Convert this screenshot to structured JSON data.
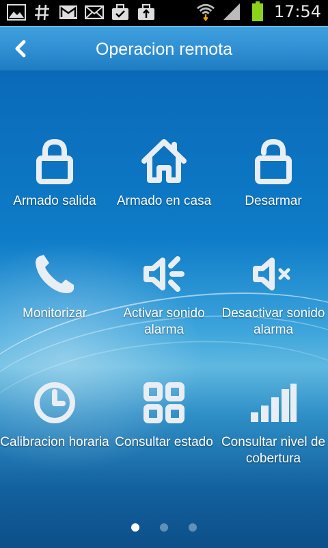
{
  "status_bar": {
    "time": "17:54",
    "icons": [
      "gallery-icon",
      "hash-icon",
      "gmail-icon",
      "mail-icon",
      "briefcase-check-icon",
      "briefcase-upload-icon",
      "wifi-icon",
      "signal-icon",
      "battery-icon"
    ]
  },
  "header": {
    "title": "Operacion remota",
    "back_icon": "chevron-left-icon"
  },
  "grid": [
    {
      "label": "Armado salida",
      "icon": "lock-icon"
    },
    {
      "label": "Armado en casa",
      "icon": "home-icon"
    },
    {
      "label": "Desarmar",
      "icon": "unlock-icon"
    },
    {
      "label": "Monitorizar",
      "icon": "phone-icon"
    },
    {
      "label": "Activar sonido alarma",
      "icon": "volume-on-icon"
    },
    {
      "label": "Desactivar sonido alarma",
      "icon": "volume-mute-icon"
    },
    {
      "label": "Calibracion horaria",
      "icon": "clock-icon"
    },
    {
      "label": "Consultar estado",
      "icon": "grid-icon"
    },
    {
      "label": "Consultar nivel de cobertura",
      "icon": "coverage-bars-icon"
    }
  ],
  "pager": {
    "pages": 3,
    "active": 1
  },
  "colors": {
    "icon": "#e8eef3",
    "title_bar": "#2f8ed2",
    "background": "#0b5fa6"
  }
}
